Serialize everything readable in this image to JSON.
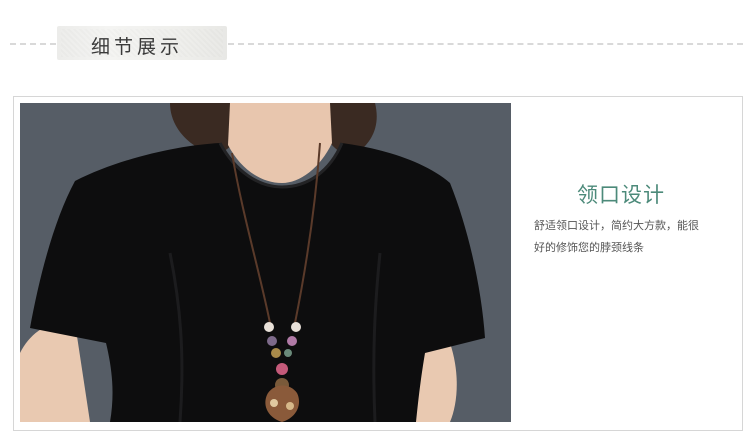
{
  "section_title": "细节展示",
  "detail": {
    "title": "领口设计",
    "desc_line1": "舒适领口设计，简约大方款，能很",
    "desc_line2": "好的修饰您的脖颈线条"
  },
  "colors": {
    "accent": "#4c8a7a",
    "text": "#555555",
    "background": "#ffffff",
    "photo_backdrop": "#585f67",
    "garment": "#0b0b0c"
  },
  "image": {
    "subject": "model-wearing-black-tshirt-with-beaded-necklace"
  }
}
